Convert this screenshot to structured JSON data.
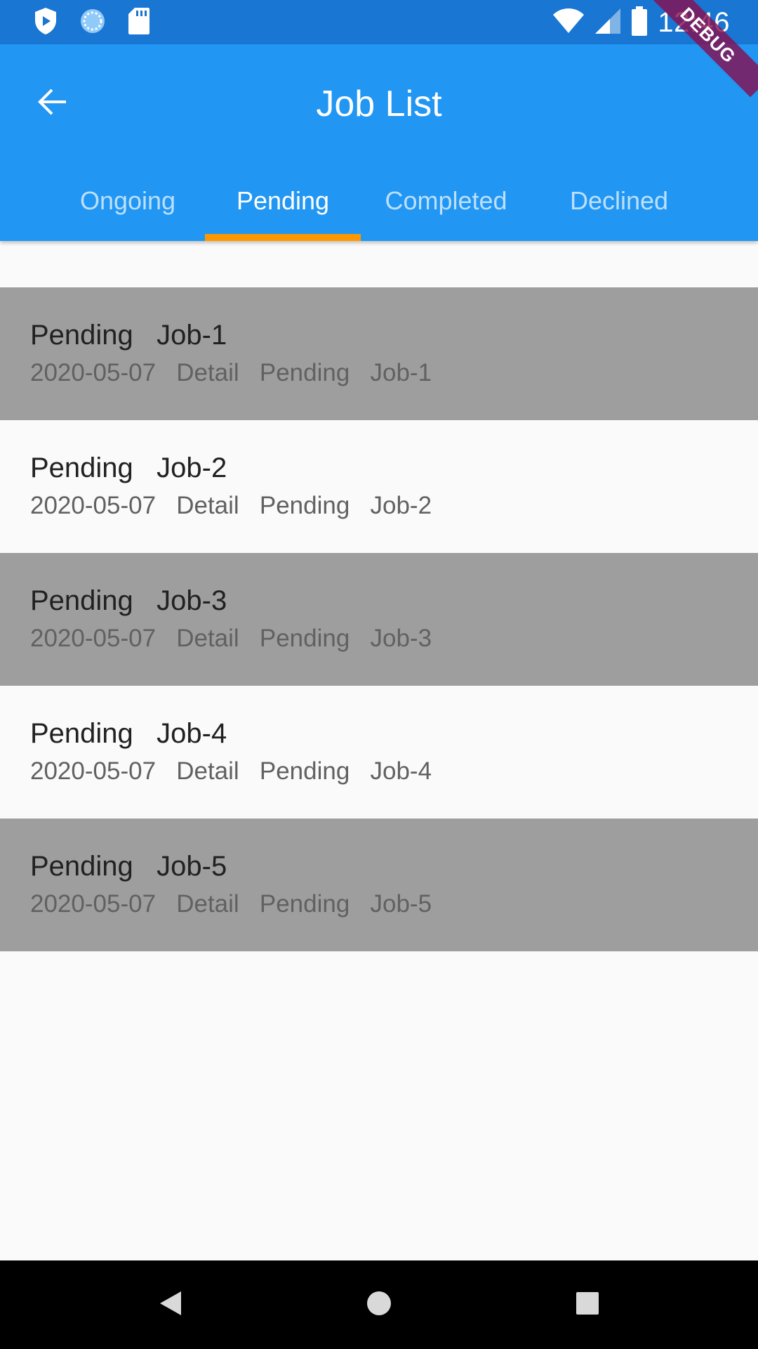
{
  "status_bar": {
    "time": "12:46",
    "left_icons": [
      "play-protect-icon",
      "sync-circle-icon",
      "sd-card-icon"
    ],
    "right_icons": [
      "wifi-icon",
      "cell-signal-icon",
      "battery-icon"
    ]
  },
  "app_bar": {
    "title": "Job List",
    "back_icon": "arrow-back-icon"
  },
  "tabs": [
    {
      "label": "Ongoing",
      "active": false
    },
    {
      "label": "Pending",
      "active": true
    },
    {
      "label": "Completed",
      "active": false
    },
    {
      "label": "Declined",
      "active": false
    }
  ],
  "jobs": [
    {
      "title": "Pending   Job-1",
      "subtitle": "2020-05-07   Detail   Pending   Job-1"
    },
    {
      "title": "Pending   Job-2",
      "subtitle": "2020-05-07   Detail   Pending   Job-2"
    },
    {
      "title": "Pending   Job-3",
      "subtitle": "2020-05-07   Detail   Pending   Job-3"
    },
    {
      "title": "Pending   Job-4",
      "subtitle": "2020-05-07   Detail   Pending   Job-4"
    },
    {
      "title": "Pending   Job-5",
      "subtitle": "2020-05-07   Detail   Pending   Job-5"
    }
  ],
  "debug_banner": "DEBUG",
  "nav_bar": {
    "icons": [
      "nav-back-icon",
      "nav-home-icon",
      "nav-recents-icon"
    ]
  },
  "colors": {
    "status_bar": "#1976D2",
    "app_bar": "#2196F3",
    "tab_indicator": "#FF9800",
    "shaded_row": "#9E9E9E",
    "background": "#FAFAFA",
    "nav_bar": "#000000"
  }
}
